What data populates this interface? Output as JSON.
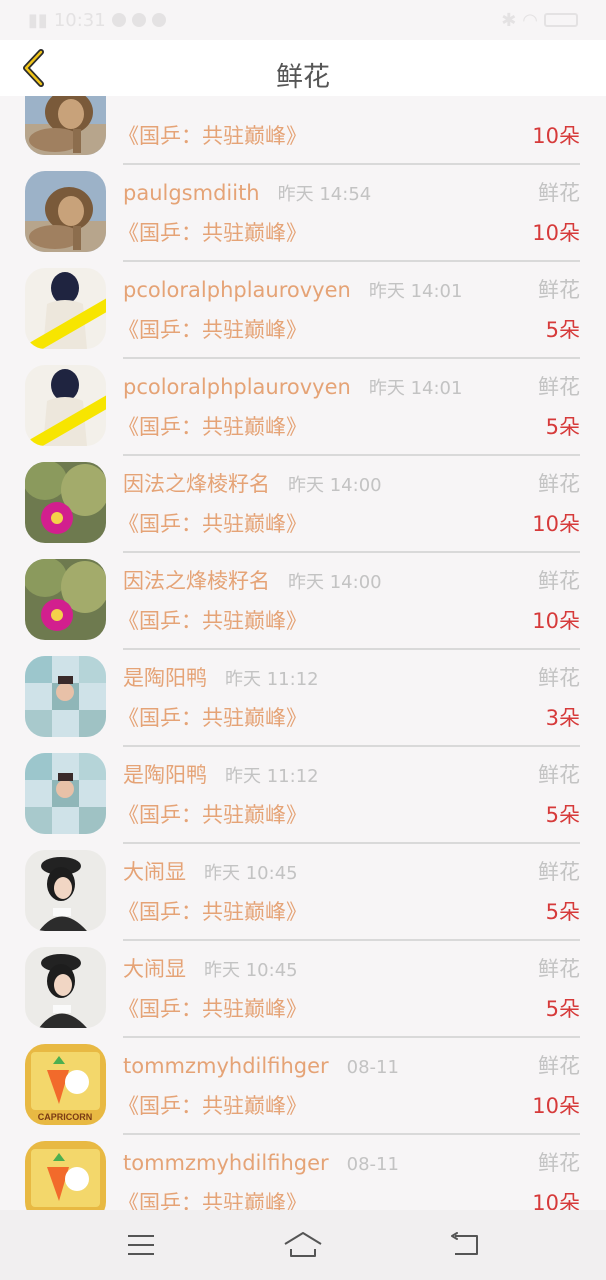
{
  "status_bar": {
    "time": "10:31"
  },
  "header": {
    "title": "鲜花"
  },
  "colors": {
    "name": "#e5a376",
    "time": "#c3c3c3",
    "amount": "#d63a3a",
    "divider": "#d9d9d9"
  },
  "rows": [
    {
      "avatar": "lion-avatar",
      "username": "",
      "time": "",
      "gift_type": "",
      "book": "《国乒：共驻巅峰》",
      "amount": "10朵"
    },
    {
      "avatar": "lion-avatar",
      "username": "paulgsmdiith",
      "time": "昨天 14:54",
      "gift_type": "鲜花",
      "book": "《国乒：共驻巅峰》",
      "amount": "10朵"
    },
    {
      "avatar": "girl-back-avatar",
      "username": "pcoloralphplaurovyen",
      "time": "昨天 14:01",
      "gift_type": "鲜花",
      "book": "《国乒：共驻巅峰》",
      "amount": "5朵"
    },
    {
      "avatar": "girl-back-avatar",
      "username": "pcoloralphplaurovyen",
      "time": "昨天 14:01",
      "gift_type": "鲜花",
      "book": "《国乒：共驻巅峰》",
      "amount": "5朵"
    },
    {
      "avatar": "cactus-avatar",
      "username": "因法之烽棱籽名",
      "time": "昨天 14:00",
      "gift_type": "鲜花",
      "book": "《国乒：共驻巅峰》",
      "amount": "10朵"
    },
    {
      "avatar": "cactus-avatar",
      "username": "因法之烽棱籽名",
      "time": "昨天 14:00",
      "gift_type": "鲜花",
      "book": "《国乒：共驻巅峰》",
      "amount": "10朵"
    },
    {
      "avatar": "collage-avatar",
      "username": "是陶阳鸭",
      "time": "昨天 11:12",
      "gift_type": "鲜花",
      "book": "《国乒：共驻巅峰》",
      "amount": "3朵"
    },
    {
      "avatar": "collage-avatar",
      "username": "是陶阳鸭",
      "time": "昨天 11:12",
      "gift_type": "鲜花",
      "book": "《国乒：共驻巅峰》",
      "amount": "5朵"
    },
    {
      "avatar": "girl-hat-avatar",
      "username": "大闹显",
      "time": "昨天 10:45",
      "gift_type": "鲜花",
      "book": "《国乒：共驻巅峰》",
      "amount": "5朵"
    },
    {
      "avatar": "girl-hat-avatar",
      "username": "大闹显",
      "time": "昨天 10:45",
      "gift_type": "鲜花",
      "book": "《国乒：共驻巅峰》",
      "amount": "5朵"
    },
    {
      "avatar": "capricorn-avatar",
      "username": "tommzmyhdilfihger",
      "time": "08-11",
      "gift_type": "鲜花",
      "book": "《国乒：共驻巅峰》",
      "amount": "10朵"
    },
    {
      "avatar": "capricorn-avatar",
      "username": "tommzmyhdilfihger",
      "time": "08-11",
      "gift_type": "鲜花",
      "book": "《国乒：共驻巅峰》",
      "amount": "10朵"
    }
  ],
  "capricorn_text": "CAPRICORN"
}
